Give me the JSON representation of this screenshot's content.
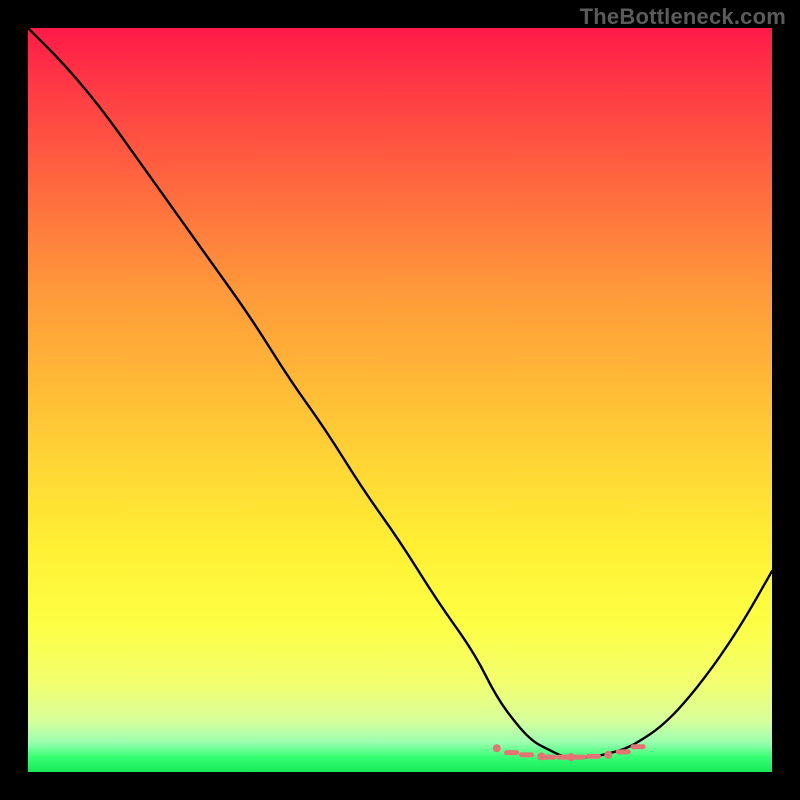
{
  "watermark": "TheBottleneck.com",
  "colors": {
    "background": "#000000",
    "curve": "#000000",
    "marker": "#e57373",
    "gradient_top": "#ff1a48",
    "gradient_bottom": "#18e85a"
  },
  "chart_data": {
    "type": "line",
    "title": "",
    "xlabel": "",
    "ylabel": "",
    "xlim": [
      0,
      100
    ],
    "ylim": [
      0,
      100
    ],
    "series": [
      {
        "name": "bottleneck-curve",
        "x": [
          0,
          5,
          10,
          15,
          20,
          25,
          30,
          35,
          40,
          45,
          50,
          55,
          60,
          63,
          66,
          68,
          70,
          72,
          74,
          76,
          78,
          80,
          82,
          85,
          88,
          92,
          96,
          100
        ],
        "y": [
          100,
          95,
          89,
          82,
          75,
          68,
          61,
          53,
          46,
          38,
          31,
          23,
          16,
          10,
          6,
          4,
          3,
          2,
          2,
          2,
          2.5,
          3,
          4,
          6,
          9,
          14,
          20,
          27
        ]
      }
    ],
    "markers": {
      "name": "low-region",
      "x": [
        63,
        65,
        67,
        69,
        70,
        72,
        73,
        74,
        76,
        78,
        80,
        82
      ],
      "y": [
        3.2,
        2.6,
        2.3,
        2.1,
        2.0,
        2.0,
        2.0,
        2.0,
        2.1,
        2.3,
        2.7,
        3.4
      ]
    }
  }
}
